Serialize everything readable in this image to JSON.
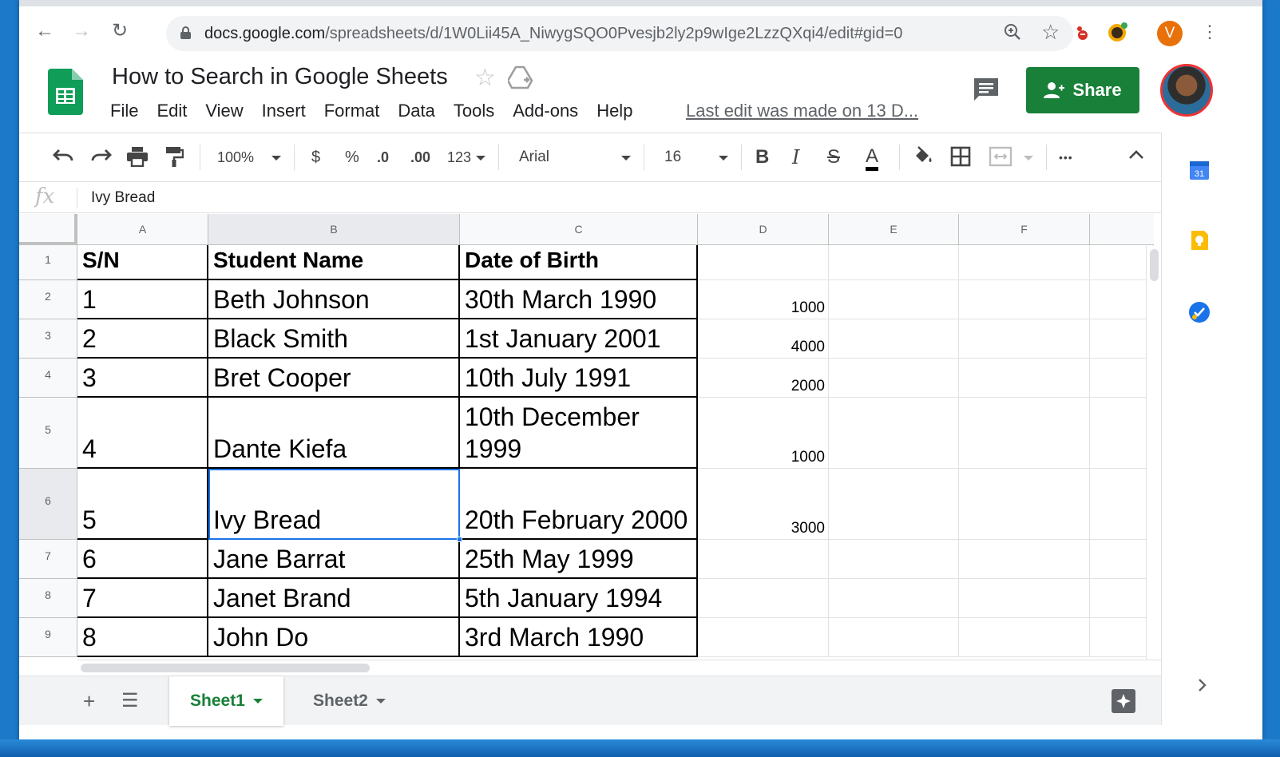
{
  "browser": {
    "url_domain": "docs.google.com",
    "url_path": "/spreadsheets/d/1W0Lii45A_NiwygSQO0Pvesjb2ly2p9wIge2LzzQXqi4/edit#gid=0",
    "profile_initial": "V"
  },
  "doc": {
    "title": "How to Search in Google Sheets",
    "share_label": "Share",
    "last_edit": "Last edit was made on 13 D...",
    "menu": [
      "File",
      "Edit",
      "View",
      "Insert",
      "Format",
      "Data",
      "Tools",
      "Add-ons",
      "Help"
    ]
  },
  "toolbar": {
    "zoom": "100%",
    "currency": "$",
    "percent": "%",
    "dec_less": ".0",
    "dec_more": ".00",
    "number_format": "123",
    "font": "Arial",
    "font_size": "16",
    "bold": "B",
    "italic": "I",
    "strike": "S",
    "text_color": "A",
    "more": "•••"
  },
  "formula_bar": {
    "fx": "fx",
    "value": "Ivy Bread"
  },
  "columns": [
    "A",
    "B",
    "C",
    "D",
    "E",
    "F"
  ],
  "rows": [
    {
      "num": "1",
      "a": "S/N",
      "b": "Student Name",
      "c": "Date of Birth",
      "d": ""
    },
    {
      "num": "2",
      "a": "1",
      "b": "Beth Johnson",
      "c": "30th March 1990",
      "d": "1000"
    },
    {
      "num": "3",
      "a": "2",
      "b": "Black Smith",
      "c": "1st January 2001",
      "d": "4000"
    },
    {
      "num": "4",
      "a": "3",
      "b": "Bret Cooper",
      "c": "10th July 1991",
      "d": "2000"
    },
    {
      "num": "5",
      "a": "4",
      "b": "Dante Kiefa",
      "c": "10th December 1999",
      "d": "1000"
    },
    {
      "num": "6",
      "a": "5",
      "b": "Ivy Bread",
      "c": "20th February 2000",
      "d": "3000"
    },
    {
      "num": "7",
      "a": "6",
      "b": "Jane Barrat",
      "c": "25th May 1999",
      "d": ""
    },
    {
      "num": "8",
      "a": "7",
      "b": "Janet Brand",
      "c": "5th January 1994",
      "d": ""
    },
    {
      "num": "9",
      "a": "8",
      "b": "John Do",
      "c": "3rd March 1990",
      "d": ""
    }
  ],
  "sheets": {
    "active": "Sheet1",
    "other": "Sheet2"
  },
  "side_panel": {
    "calendar_day": "31"
  },
  "colors": {
    "accent": "#188038",
    "selection": "#1a73e8"
  }
}
